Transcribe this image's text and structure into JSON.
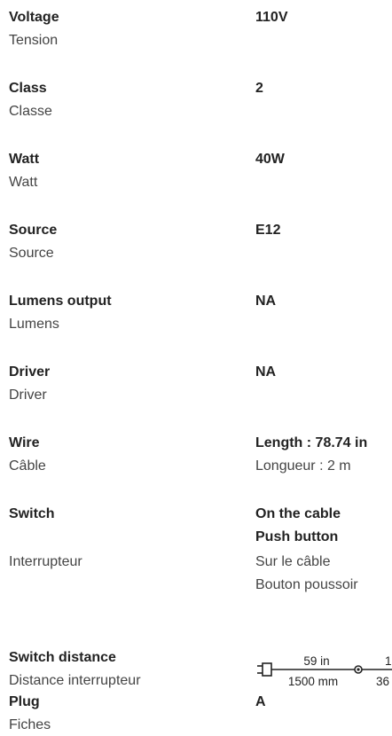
{
  "specs": [
    {
      "key": "voltage",
      "label_en": "Voltage",
      "label_fr": "Tension",
      "value_en": "110V",
      "value_fr": ""
    },
    {
      "key": "class",
      "label_en": "Class",
      "label_fr": "Classe",
      "value_en": "2",
      "value_fr": ""
    },
    {
      "key": "watt",
      "label_en": "Watt",
      "label_fr": "Watt",
      "value_en": "40W",
      "value_fr": ""
    },
    {
      "key": "source",
      "label_en": "Source",
      "label_fr": "Source",
      "value_en": "E12",
      "value_fr": ""
    },
    {
      "key": "lumens",
      "label_en": "Lumens output",
      "label_fr": "Lumens",
      "value_en": "NA",
      "value_fr": ""
    },
    {
      "key": "driver",
      "label_en": "Driver",
      "label_fr": "Driver",
      "value_en": "NA",
      "value_fr": ""
    },
    {
      "key": "wire",
      "label_en": "Wire",
      "label_fr": "Câble",
      "value_en": "Length : 78.74 in",
      "value_fr": "Longueur : 2 m"
    }
  ],
  "switch": {
    "label_en": "Switch",
    "label_fr": "Interrupteur",
    "value_en_line1": "On the cable",
    "value_en_line2": "Push button",
    "value_fr_line1": "Sur le câble",
    "value_fr_line2": "Bouton poussoir"
  },
  "switch_distance": {
    "label_en": "Switch distance",
    "label_fr": "Distance interrupteur",
    "top_value_1": "59 in",
    "bottom_value_1": "1500 mm",
    "top_value_2": "1",
    "bottom_value_2": "36"
  },
  "plug": {
    "label_en": "Plug",
    "label_fr": "Fiches",
    "value_en": "A"
  }
}
